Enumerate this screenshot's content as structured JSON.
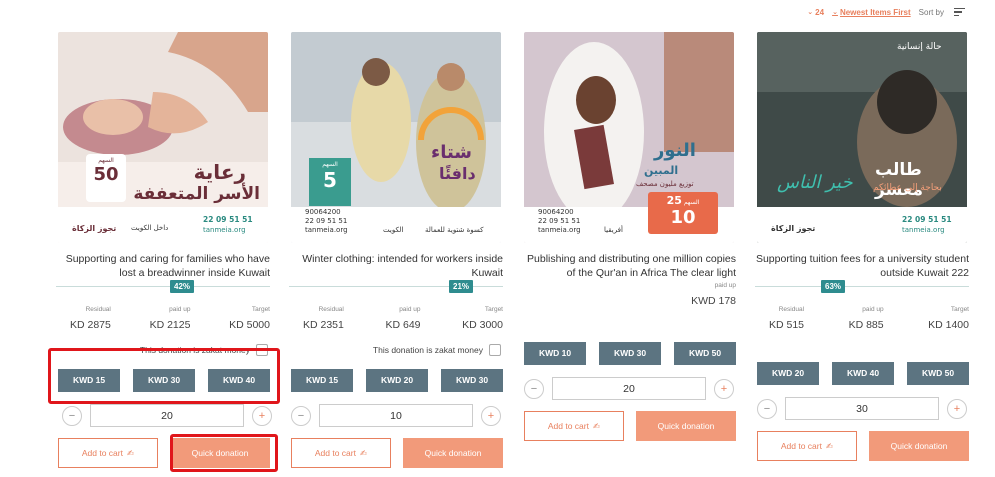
{
  "sort": {
    "count": "24",
    "order": "Newest Items First",
    "label": "Sort by"
  },
  "cards": [
    {
      "image": {
        "ar_title1": "رعاية",
        "ar_title2": "الأسر المتعففة",
        "price_label": "السهم",
        "price": "50",
        "phone": "22 09 51 51",
        "web": "tanmeia.org",
        "ar_zakat": "تجوز الزكاة",
        "ar_inside": "داخل الكويت"
      },
      "title": "Supporting and caring for families who have lost a breadwinner inside Kuwait",
      "badge": "42%",
      "stats": [
        {
          "label": "Residual",
          "value": "KD  2875"
        },
        {
          "label": "paid up",
          "value": "KD  2125"
        },
        {
          "label": "Target",
          "value": "KD  5000"
        }
      ],
      "zakat": "This donation is zakat money",
      "amounts": [
        "KWD 15",
        "KWD 30",
        "KWD 40"
      ],
      "qty": "20",
      "add_to_cart": "Add to cart",
      "quick": "Quick donation"
    },
    {
      "image": {
        "ar_title1": "شتاء",
        "ar_title2": "دافئًا",
        "price_label": "السهم",
        "price": "5",
        "phone1": "90064200",
        "phone2": "22 09 51 51",
        "web": "tanmeia.org",
        "ar_sub": "كسوة شتوية للعمالة",
        "ar_loc": "الكويت"
      },
      "title": "Winter clothing: intended for workers inside Kuwait",
      "badge": "21%",
      "stats": [
        {
          "label": "Residual",
          "value": "KD  2351"
        },
        {
          "label": "paid up",
          "value": "KD  649"
        },
        {
          "label": "Target",
          "value": "KD  3000"
        }
      ],
      "zakat": "This donation is zakat money",
      "amounts": [
        "KWD 15",
        "KWD 20",
        "KWD 30"
      ],
      "qty": "10",
      "add_to_cart": "Add to cart",
      "quick": "Quick donation"
    },
    {
      "image": {
        "ar_title1": "النور",
        "ar_title2": "المبين",
        "ar_sub": "توزيع مليون مصحف",
        "price_label": "السهم",
        "price": "25",
        "price2": "10",
        "phone1": "90064200",
        "phone2": "22 09 51 51",
        "web": "tanmeia.org",
        "ar_loc": "أفريقيا"
      },
      "title": "Publishing and distributing one million copies of the Qur'an in Africa The clear light",
      "stats": [
        {
          "label": "paid up",
          "value": "KWD  178"
        }
      ],
      "amounts": [
        "KWD 10",
        "KWD 30",
        "KWD 50"
      ],
      "qty": "20",
      "add_to_cart": "Add to cart",
      "quick": "Quick donation"
    },
    {
      "image": {
        "ar_tag": "حالة إنسانية",
        "ar_title1": "طالب معسر",
        "ar_sub": "بحاجة إلى عطائكم",
        "ar_mark": "خير الناس",
        "phone": "22 09 51 51",
        "web": "tanmeia.org",
        "ar_zakat": "تجوز الزكاة"
      },
      "title": "Supporting tuition fees for a university student outside Kuwait 222",
      "badge": "63%",
      "stats": [
        {
          "label": "Residual",
          "value": "KD  515"
        },
        {
          "label": "paid up",
          "value": "KD  885"
        },
        {
          "label": "Target",
          "value": "KD  1400"
        }
      ],
      "amounts": [
        "KWD 20",
        "KWD 40",
        "KWD 50"
      ],
      "qty": "30",
      "add_to_cart": "Add to cart",
      "quick": "Quick donation"
    }
  ],
  "colors": {
    "accent": "#e8805e",
    "quick": "#f29a7a",
    "amount": "#5c7481",
    "badge": "#2e8c8f",
    "highlight": "#e0161b"
  }
}
